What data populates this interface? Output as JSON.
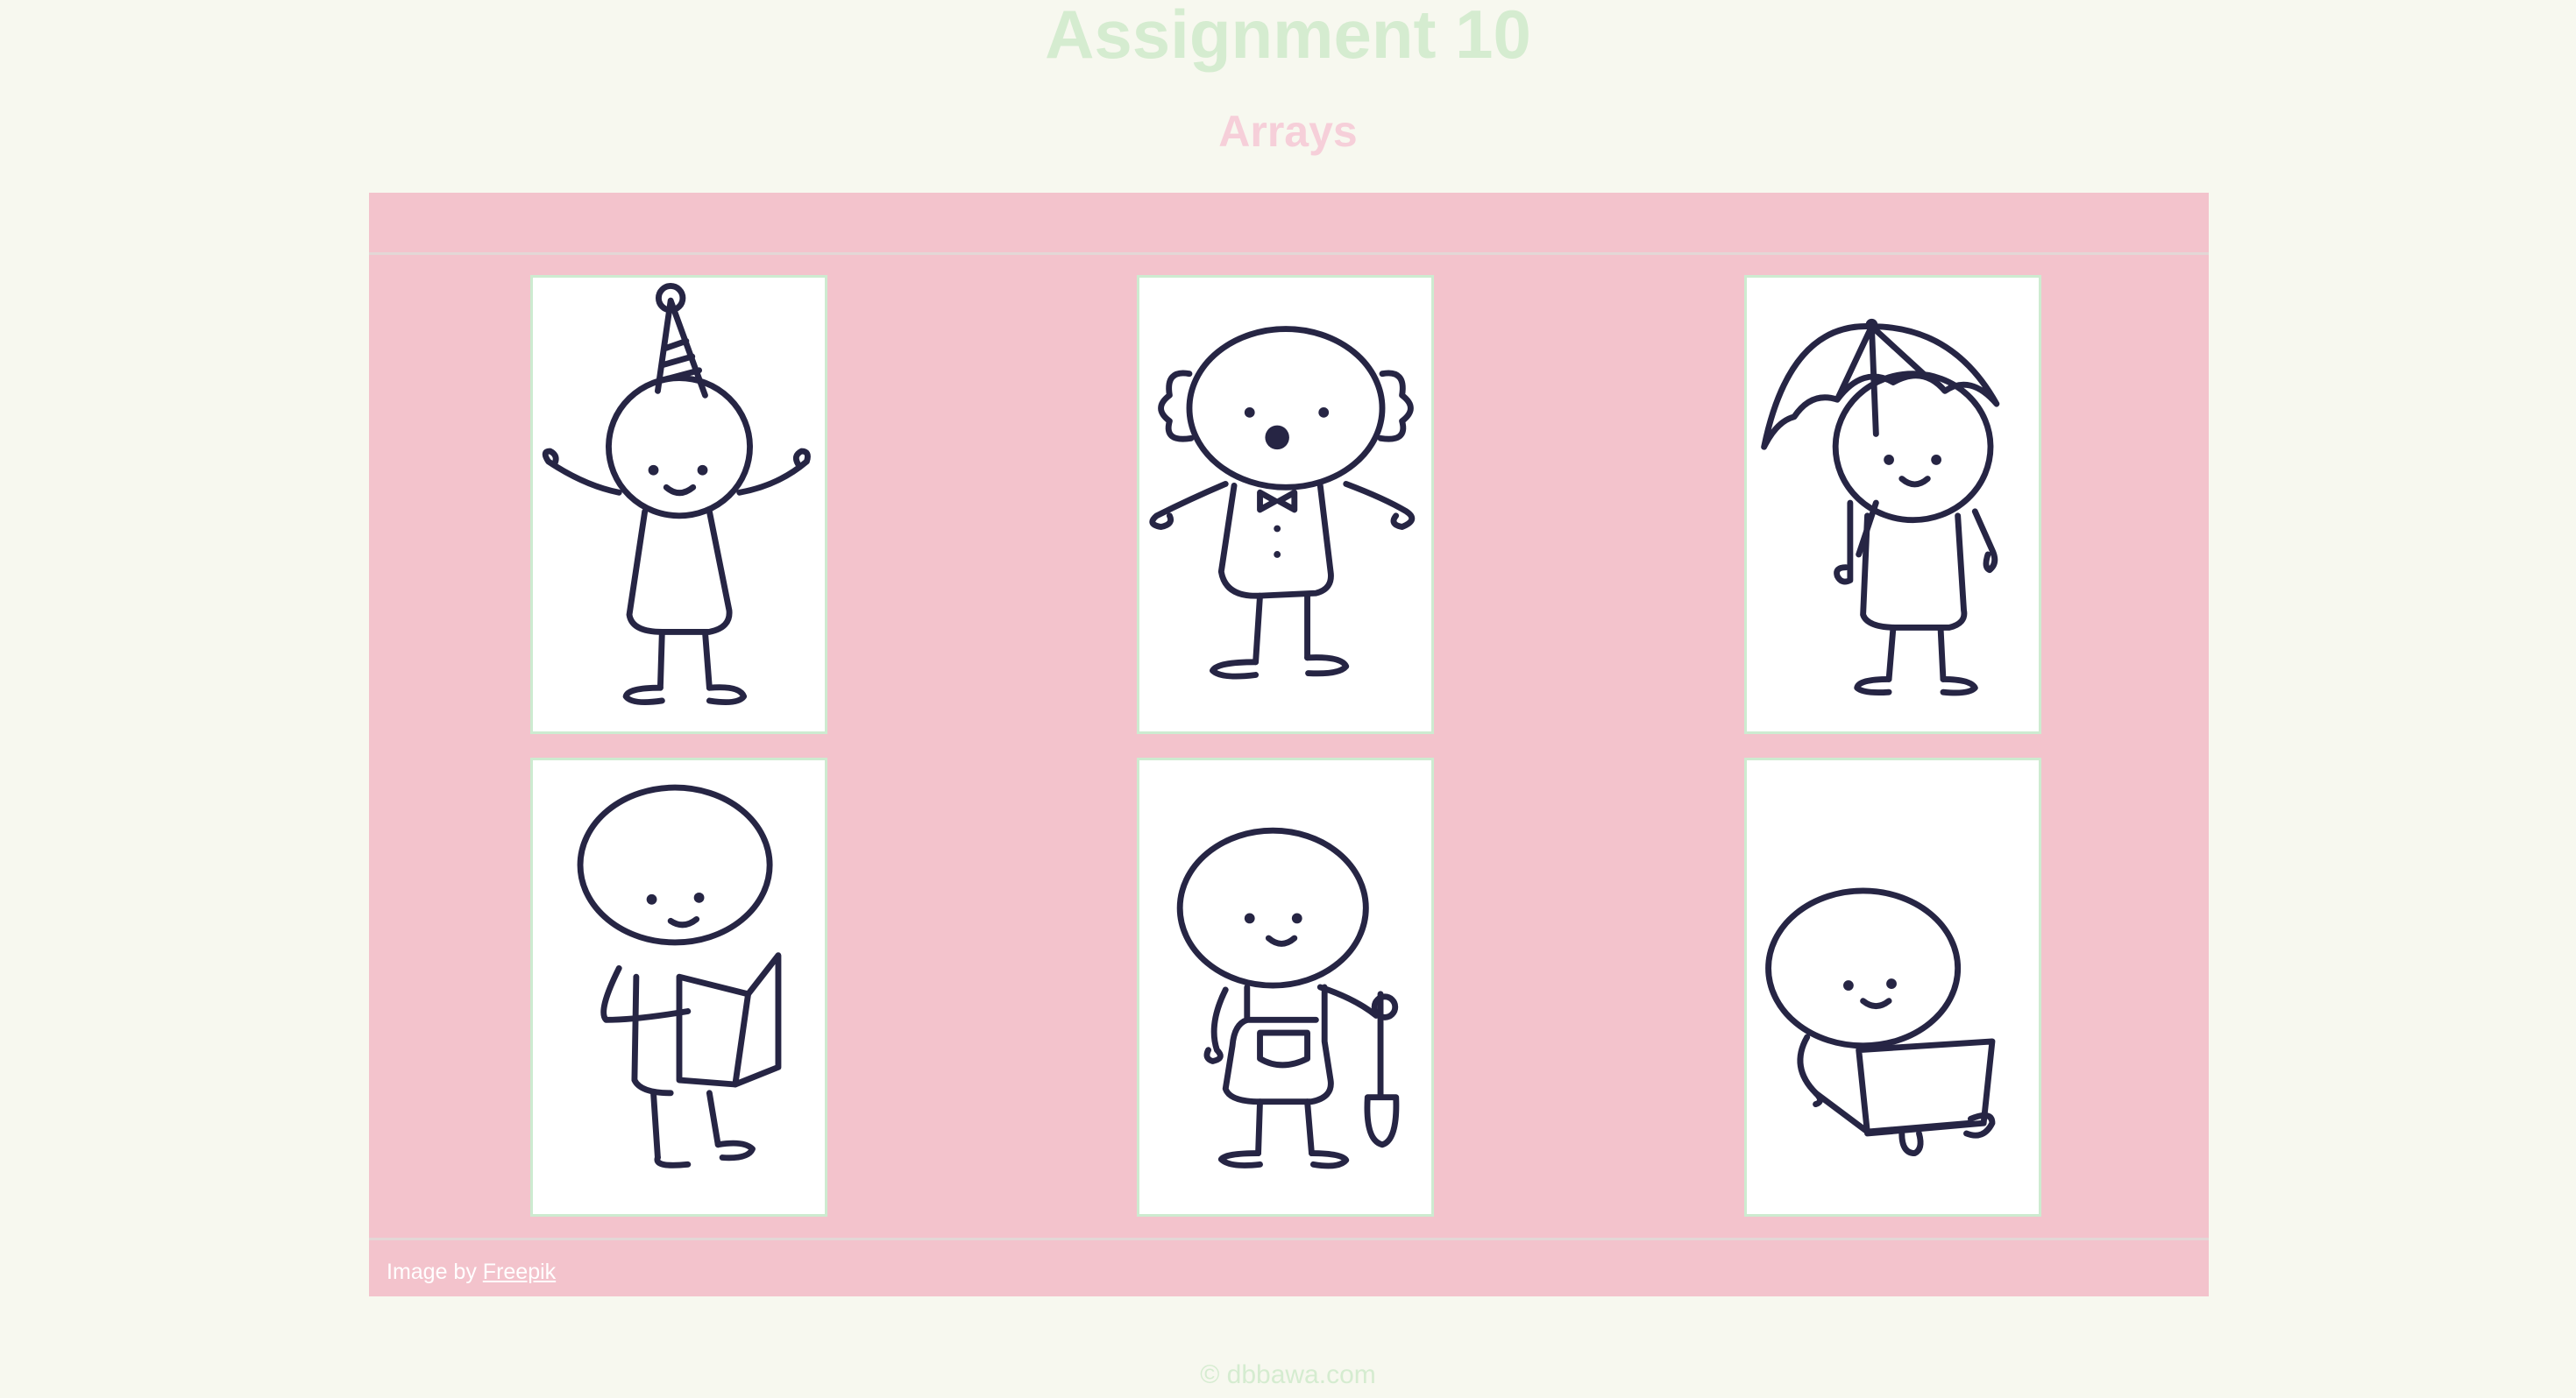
{
  "header": {
    "title": "Assignment 10",
    "subtitle": "Arrays"
  },
  "gallery": {
    "images": [
      {
        "name": "party-hat-stick-figure"
      },
      {
        "name": "clown-stick-figure"
      },
      {
        "name": "umbrella-stick-figure"
      },
      {
        "name": "reading-stick-figure"
      },
      {
        "name": "gardener-stick-figure"
      },
      {
        "name": "laptop-stick-figure"
      }
    ],
    "credit_prefix": "Image by",
    "credit_link": "Freepik"
  },
  "footer": {
    "text": "© dbbawa.com"
  },
  "colors": {
    "background": "#f7f8ef",
    "board": "#f3c3cc",
    "title": "#d5ecd0",
    "subtitle": "#f6cfd9",
    "ink": "#262544"
  }
}
